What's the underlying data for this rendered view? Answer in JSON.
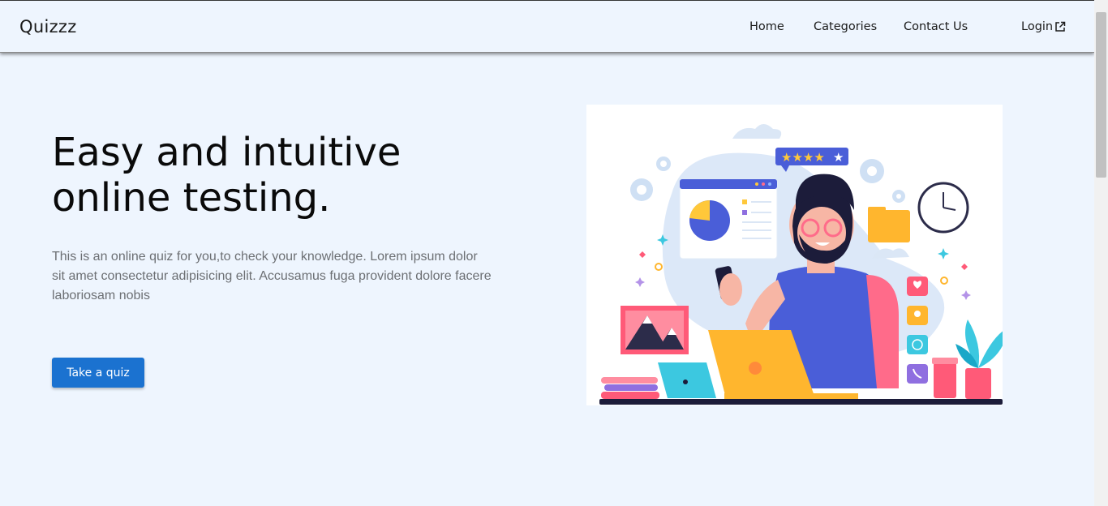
{
  "navbar": {
    "brand": "Quizzz",
    "links": {
      "home": "Home",
      "categories": "Categories",
      "contact": "Contact Us",
      "login": "Login"
    },
    "login_icon": "external-link-icon"
  },
  "hero": {
    "headline": "Easy and intuitive online testing.",
    "description": "This is an online quiz for you,to check your knowledge. Lorem ipsum dolor sit amet consectetur adipisicing elit. Accusamus fuga provident dolore facere laboriosam nobis",
    "cta_label": "Take a quiz",
    "illustration_rating": 5
  },
  "colors": {
    "background": "#eef5fe",
    "accent": "#1b72d0",
    "heading": "#0a0a0a",
    "body_text": "#6c6f73"
  }
}
